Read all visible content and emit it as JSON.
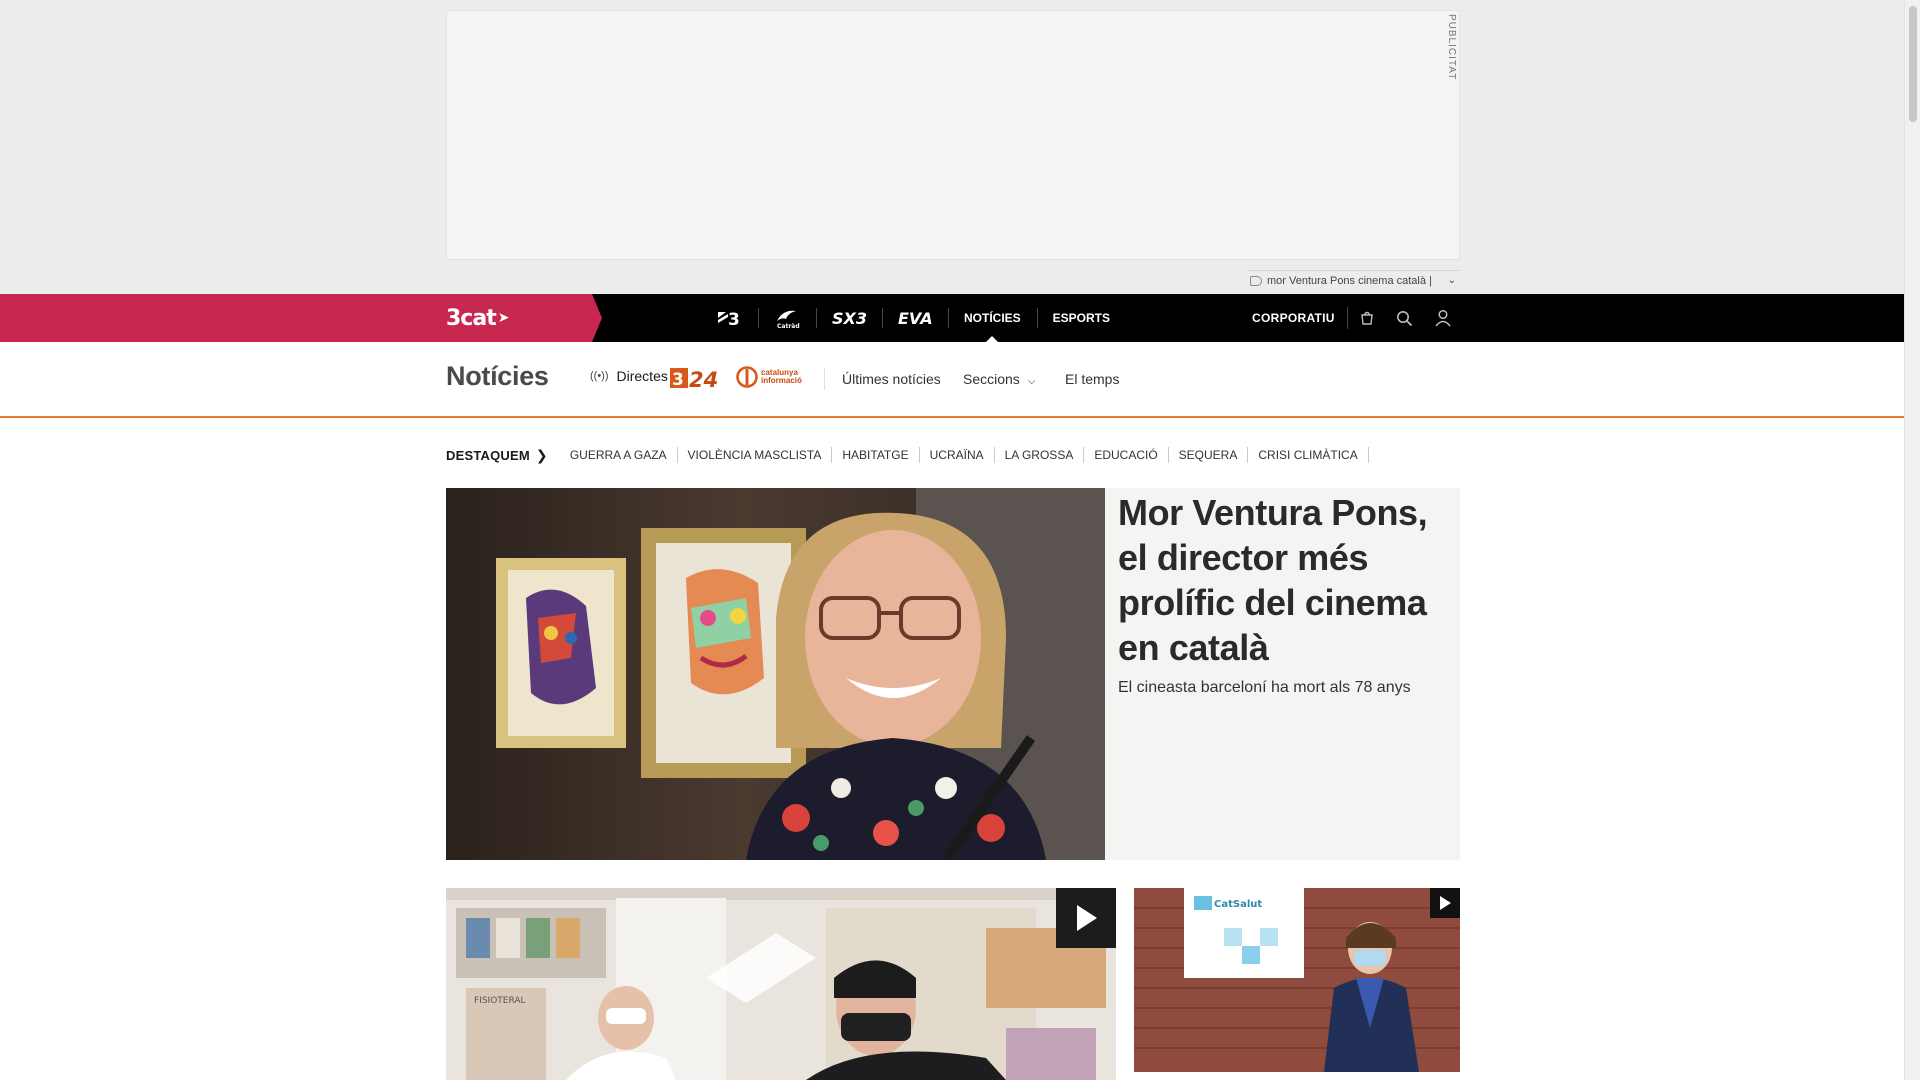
{
  "ad": {
    "label": "PUBLICITAT",
    "topic": "mor Ventura Pons cinema català |"
  },
  "topbar": {
    "brand": "3cat",
    "channels": [
      {
        "label": "3",
        "icon": "tv3-logo"
      },
      {
        "label": "Cat ràdio",
        "icon": "catradio-logo"
      },
      {
        "label": "SX3",
        "icon": "sx3-logo"
      },
      {
        "label": "EVA",
        "icon": "eva-logo"
      },
      {
        "label": "NOTÍCIES",
        "icon": ""
      },
      {
        "label": "ESPORTS",
        "icon": ""
      }
    ],
    "corporate": "CORPORATIU"
  },
  "section": {
    "title": "Notícies",
    "live": "Directes",
    "logo_324": "3/24",
    "logo_ci": [
      "catalunya",
      "informació"
    ],
    "links": {
      "latest": "Últimes notícies",
      "sections": "Seccions",
      "weather": "El temps"
    }
  },
  "destaquem": {
    "title": "DESTAQUEM",
    "items": [
      "GUERRA A GAZA",
      "VIOLÈNCIA MASCLISTA",
      "HABITATGE",
      "UCRAÏNA",
      "LA GROSSA",
      "EDUCACIÓ",
      "SEQUERA",
      "CRISI CLIMÀTICA"
    ]
  },
  "hero": {
    "title": "Mor Ventura Pons, el director més prolífic del cinema en català",
    "subtitle": "El cineasta barceloní ha mort als 78 anys"
  },
  "cards": [
    {
      "image": "pharmacy-photo",
      "badge": "video-play-icon"
    },
    {
      "image": "woman-at-clinic-photo",
      "badge": "video-play-icon"
    }
  ],
  "colors": {
    "brand": "#c8274f",
    "accent_line": "#e87a2a",
    "topbar": "#000000"
  }
}
